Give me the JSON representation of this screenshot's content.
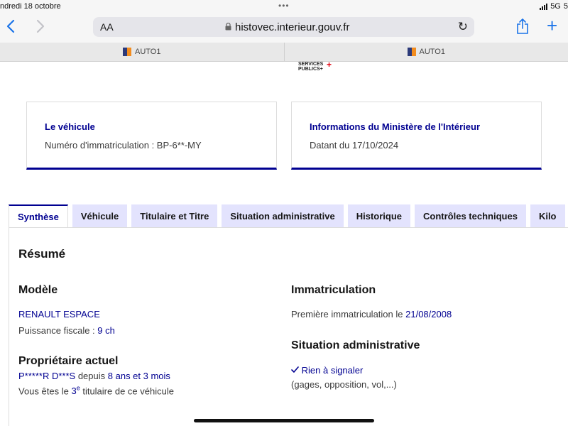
{
  "status_bar": {
    "date": "ndredi 18 octobre",
    "network": "5G",
    "extra": "5"
  },
  "browser": {
    "text_size_label": "AA",
    "url": "histovec.interieur.gouv.fr",
    "tabs": [
      {
        "title": "AUTO1"
      },
      {
        "title": "AUTO1"
      }
    ]
  },
  "logo": {
    "line1": "SERVICES",
    "line2": "PUBLICS+"
  },
  "cards": {
    "vehicle": {
      "title": "Le véhicule",
      "text": "Numéro d'immatriculation : BP-6**-MY"
    },
    "ministry": {
      "title": "Informations du Ministère de l'Intérieur",
      "text": "Datant du 17/10/2024"
    }
  },
  "tabs": [
    {
      "label": "Synthèse"
    },
    {
      "label": "Véhicule"
    },
    {
      "label": "Titulaire et Titre"
    },
    {
      "label": "Situation administrative"
    },
    {
      "label": "Historique"
    },
    {
      "label": "Contrôles techniques"
    },
    {
      "label": "Kilo"
    }
  ],
  "summary": {
    "title": "Résumé",
    "model": {
      "heading": "Modèle",
      "name": "RENAULT ESPACE",
      "power_label": "Puissance fiscale :",
      "power_value": "9 ch"
    },
    "owner": {
      "heading": "Propriétaire actuel",
      "name": "P*****R D***S",
      "since_label": "depuis",
      "since_value": "8 ans et 3 mois",
      "rank_prefix": "Vous êtes le",
      "rank_number": "3",
      "rank_suffix": "e",
      "rank_text": "titulaire de ce véhicule"
    },
    "registration": {
      "heading": "Immatriculation",
      "label": "Première immatriculation le",
      "date": "21/08/2008"
    },
    "admin": {
      "heading": "Situation administrative",
      "status": "Rien à signaler",
      "detail": "(gages, opposition, vol,...)"
    }
  }
}
